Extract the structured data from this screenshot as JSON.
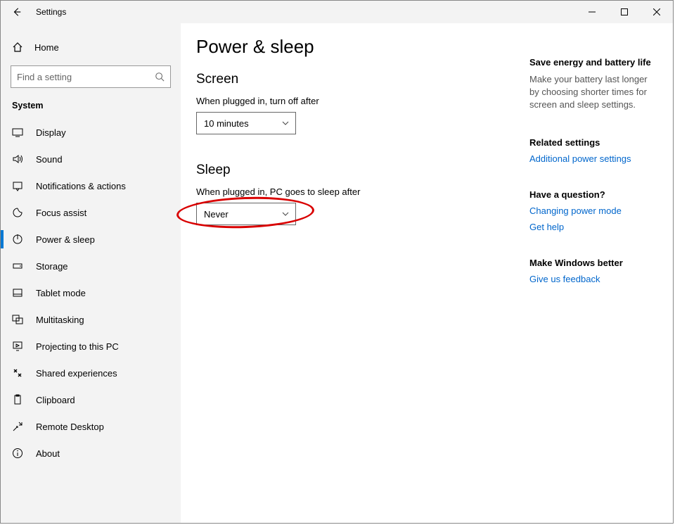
{
  "window": {
    "title": "Settings"
  },
  "sidebar": {
    "home_label": "Home",
    "search_placeholder": "Find a setting",
    "group_label": "System",
    "items": [
      {
        "label": "Display",
        "icon": "display-icon",
        "active": false
      },
      {
        "label": "Sound",
        "icon": "sound-icon",
        "active": false
      },
      {
        "label": "Notifications & actions",
        "icon": "notifications-icon",
        "active": false
      },
      {
        "label": "Focus assist",
        "icon": "focus-assist-icon",
        "active": false
      },
      {
        "label": "Power & sleep",
        "icon": "power-icon",
        "active": true
      },
      {
        "label": "Storage",
        "icon": "storage-icon",
        "active": false
      },
      {
        "label": "Tablet mode",
        "icon": "tablet-icon",
        "active": false
      },
      {
        "label": "Multitasking",
        "icon": "multitasking-icon",
        "active": false
      },
      {
        "label": "Projecting to this PC",
        "icon": "projecting-icon",
        "active": false
      },
      {
        "label": "Shared experiences",
        "icon": "shared-icon",
        "active": false
      },
      {
        "label": "Clipboard",
        "icon": "clipboard-icon",
        "active": false
      },
      {
        "label": "Remote Desktop",
        "icon": "remote-icon",
        "active": false
      },
      {
        "label": "About",
        "icon": "about-icon",
        "active": false
      }
    ]
  },
  "main": {
    "title": "Power & sleep",
    "screen": {
      "heading": "Screen",
      "label": "When plugged in, turn off after",
      "value": "10 minutes"
    },
    "sleep": {
      "heading": "Sleep",
      "label": "When plugged in, PC goes to sleep after",
      "value": "Never",
      "highlighted": true
    }
  },
  "aside": {
    "energy": {
      "heading": "Save energy and battery life",
      "text": "Make your battery last longer by choosing shorter times for screen and sleep settings."
    },
    "related": {
      "heading": "Related settings",
      "link": "Additional power settings"
    },
    "question": {
      "heading": "Have a question?",
      "links": [
        "Changing power mode",
        "Get help"
      ]
    },
    "feedback": {
      "heading": "Make Windows better",
      "link": "Give us feedback"
    }
  }
}
